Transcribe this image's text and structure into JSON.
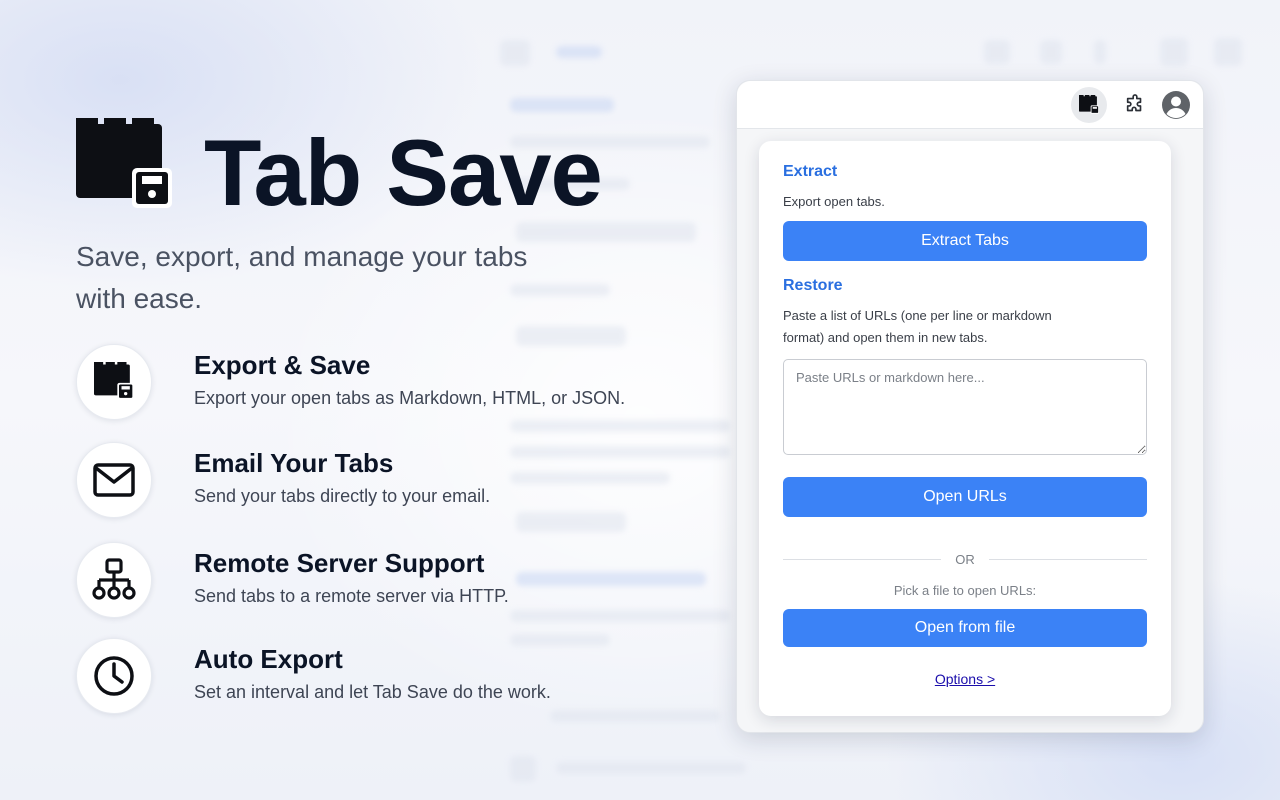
{
  "hero": {
    "title": "Tab Save",
    "subtitle": "Save, export, and manage your tabs with ease.",
    "logo_icon": "folder-save-icon"
  },
  "features": [
    {
      "icon": "folder-save-icon",
      "title": "Export & Save",
      "desc": "Export your open tabs as Markdown, HTML, or JSON."
    },
    {
      "icon": "envelope-icon",
      "title": "Email Your Tabs",
      "desc": "Send your tabs directly to your email."
    },
    {
      "icon": "network-icon",
      "title": "Remote Server Support",
      "desc": "Send tabs to a remote server via HTTP."
    },
    {
      "icon": "clock-icon",
      "title": "Auto Export",
      "desc": "Set an interval and let Tab Save do the work."
    }
  ],
  "toolbar": {
    "extension_icon": "tab-save-extension-icon",
    "puzzle_icon": "puzzle-icon",
    "profile_icon": "profile-icon"
  },
  "popup": {
    "extract": {
      "title": "Extract",
      "desc": "Export open tabs.",
      "button": "Extract Tabs"
    },
    "restore": {
      "title": "Restore",
      "desc": "Paste a list of URLs (one per line or markdown format) and open them in new tabs.",
      "placeholder": "Paste URLs or markdown here...",
      "button": "Open URLs"
    },
    "or_label": "OR",
    "pick_label": "Pick a file to open URLs:",
    "file_button": "Open from file",
    "options_link": "Options >"
  },
  "colors": {
    "accent": "#3b82f6",
    "section_title": "#2a6fe0",
    "link": "#1a0dab",
    "heading": "#0b1426"
  }
}
